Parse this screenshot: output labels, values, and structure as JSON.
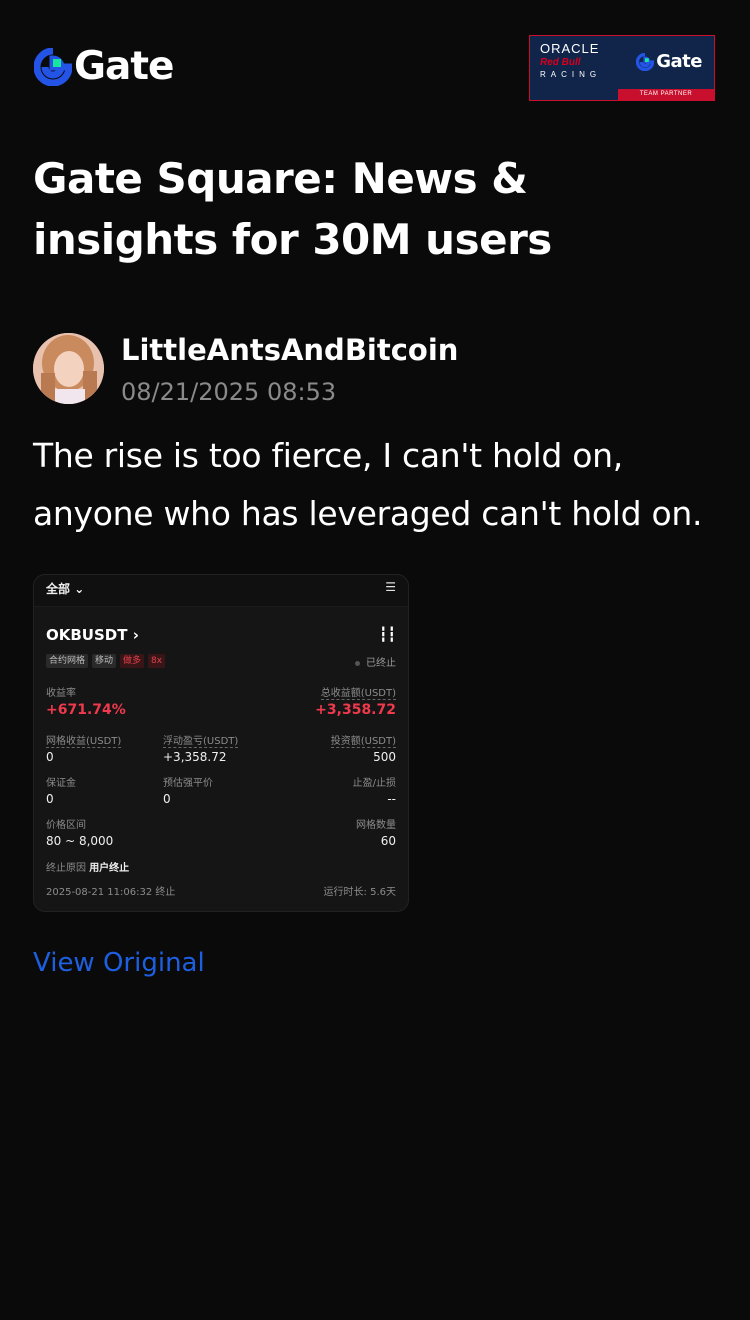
{
  "brand": {
    "logo_text": "Gate",
    "logo_icon": "gate-logo-icon",
    "accent_blue": "#2354e6",
    "accent_green": "#17e6a1"
  },
  "partner_badge": {
    "oracle": "ORACLE",
    "redbull": "Red Bull",
    "racing": "RACING",
    "gate": "Gate",
    "band": "TEAM PARTNER"
  },
  "page_title": "Gate Square: News & insights for 30M users",
  "post": {
    "author": "LittleAntsAndBitcoin",
    "time": "08/21/2025 08:53",
    "body": "The rise is too fierce, I can't hold on, anyone who has leveraged can't hold on.",
    "view_original": "View Original"
  },
  "screenshot": {
    "all_label": "全部",
    "filter_icon": "filter-icon",
    "pair": "OKBUSDT",
    "candle_icon": "candlestick-icon",
    "tags": [
      "合约网格",
      "移动",
      "做多",
      "8x"
    ],
    "status": "已终止",
    "yield_label": "收益率",
    "yield_value": "+671.74%",
    "total_profit_label": "总收益额(USDT)",
    "total_profit_value": "+3,358.72",
    "grid_profit_label": "网格收益(USDT)",
    "grid_profit_value": "0",
    "floating_pnl_label": "浮动盈亏(USDT)",
    "floating_pnl_value": "+3,358.72",
    "investment_label": "投资额(USDT)",
    "investment_value": "500",
    "margin_label": "保证金",
    "margin_value": "0",
    "liq_price_label": "预估强平价",
    "liq_price_value": "0",
    "tpsl_label": "止盈/止损",
    "tpsl_value": "--",
    "price_range_label": "价格区间",
    "price_range_value": "80 ~ 8,000",
    "grid_count_label": "网格数量",
    "grid_count_value": "60",
    "stop_reason_label": "终止原因",
    "stop_reason_value": "用户终止",
    "stop_time": "2025-08-21 11:06:32 终止",
    "runtime": "运行时长: 5.6天",
    "profit_red": "#f0394c"
  }
}
